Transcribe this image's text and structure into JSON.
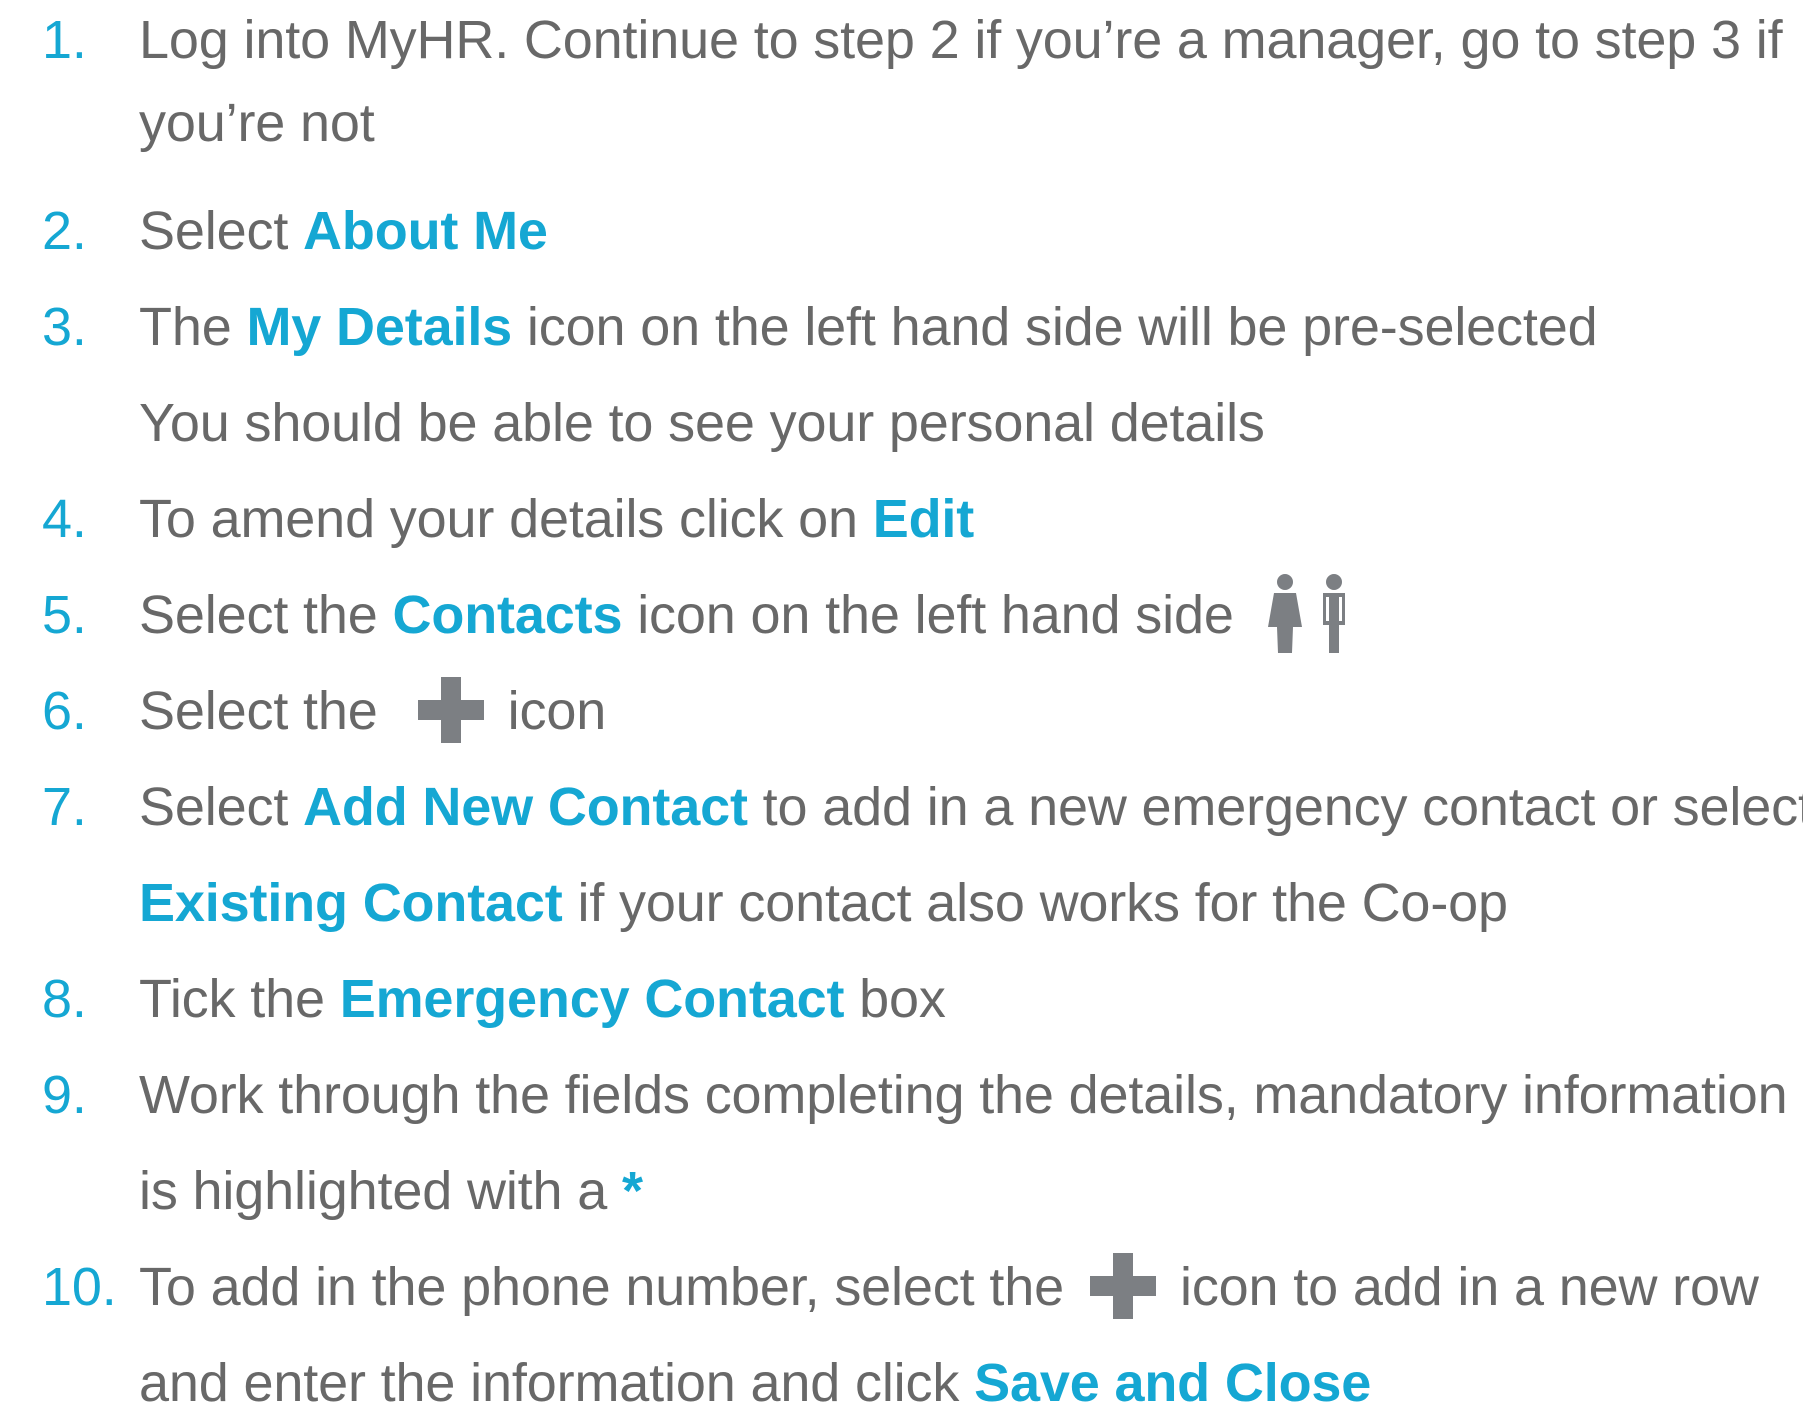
{
  "steps": [
    {
      "num": "1.",
      "l1": "Log into MyHR. Continue to step 2 if you’re a manager, go to step 3 if",
      "l2": "you’re not"
    },
    {
      "num": "2.",
      "pre": "Select ",
      "hl": "About Me"
    },
    {
      "num": "3.",
      "pre": "The ",
      "hl": "My Details",
      "post": " icon on the left hand side will be pre-selected",
      "l2": "You should be able to see your personal details"
    },
    {
      "num": "4.",
      "pre": "To amend your details click on ",
      "hl": "Edit"
    },
    {
      "num": "5.",
      "pre": "Select the ",
      "hl": "Contacts",
      "post": " icon on the left hand side"
    },
    {
      "num": "6.",
      "pre": "Select the",
      "post": "icon"
    },
    {
      "num": "7.",
      "pre": "Select ",
      "hl": "Add New Contact",
      "post": " to add in a new emergency contact or select",
      "l2_hl": "Existing Contact",
      "l2_post": " if your contact also works for the Co-op"
    },
    {
      "num": "8.",
      "pre": "Tick the ",
      "hl": "Emergency Contact",
      "post": " box"
    },
    {
      "num": "9.",
      "l1": "Work through the fields completing the details, mandatory information",
      "l2_pre": "is highlighted with a ",
      "l2_hl": "*"
    },
    {
      "num": "10.",
      "pre": "To add in the phone number, select the",
      "post": "icon to add in a new row",
      "l2_pre": "and enter the information and click ",
      "l2_hl": "Save and Close"
    }
  ],
  "icons": {
    "contacts": "contacts-icon",
    "plus": "plus-icon"
  },
  "colors": {
    "accent": "#15a7d3",
    "text": "#686868",
    "icon": "#7c7f83"
  }
}
